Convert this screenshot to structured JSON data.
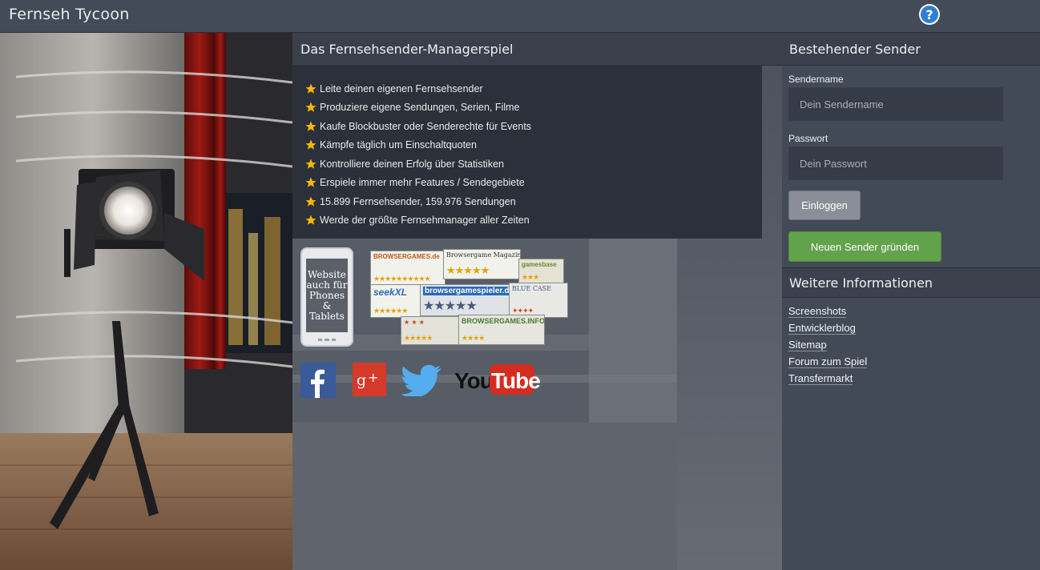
{
  "app": {
    "title": "Fernseh Tycoon"
  },
  "intro": {
    "title": "Das Fernsehsender-Managerspiel",
    "features": [
      "Leite deinen eigenen Fernsehsender",
      "Produziere eigene Sendungen, Serien, Filme",
      "Kaufe Blockbuster oder Senderechte für Events",
      "Kämpfe täglich um Einschaltquoten",
      "Kontrolliere deinen Erfolg über Statistiken",
      "Erspiele immer mehr Features / Sendegebiete",
      "15.899 Fernsehsender, 159.976 Sendungen",
      "Werde der größte Fernsehmanager aller Zeiten"
    ],
    "phone_text": "Website auch für Phones & Tablets",
    "badges": [
      "BROWSERGAMES.de",
      "Browsergame Magazin",
      "gamesbase",
      "seekXL",
      "browsergamespieler.de",
      "BLUE CASE",
      "BROWSERGAMES.INFO"
    ],
    "social": {
      "youtube_a": "You",
      "youtube_b": "Tube"
    }
  },
  "login": {
    "title": "Bestehender Sender",
    "sendername_label": "Sendername",
    "sendername_placeholder": "Dein Sendername",
    "password_label": "Passwort",
    "password_placeholder": "Dein Passwort",
    "login_button": "Einloggen",
    "new_button": "Neuen Sender gründen"
  },
  "info": {
    "title": "Weitere Informationen",
    "links": [
      "Screenshots",
      "Entwicklerblog",
      "Sitemap",
      "Forum zum Spiel",
      "Transfermarkt"
    ]
  },
  "colors": {
    "accent_green": "#62a24a",
    "header_bg": "#444b58",
    "help_blue": "#2f7fd6"
  }
}
